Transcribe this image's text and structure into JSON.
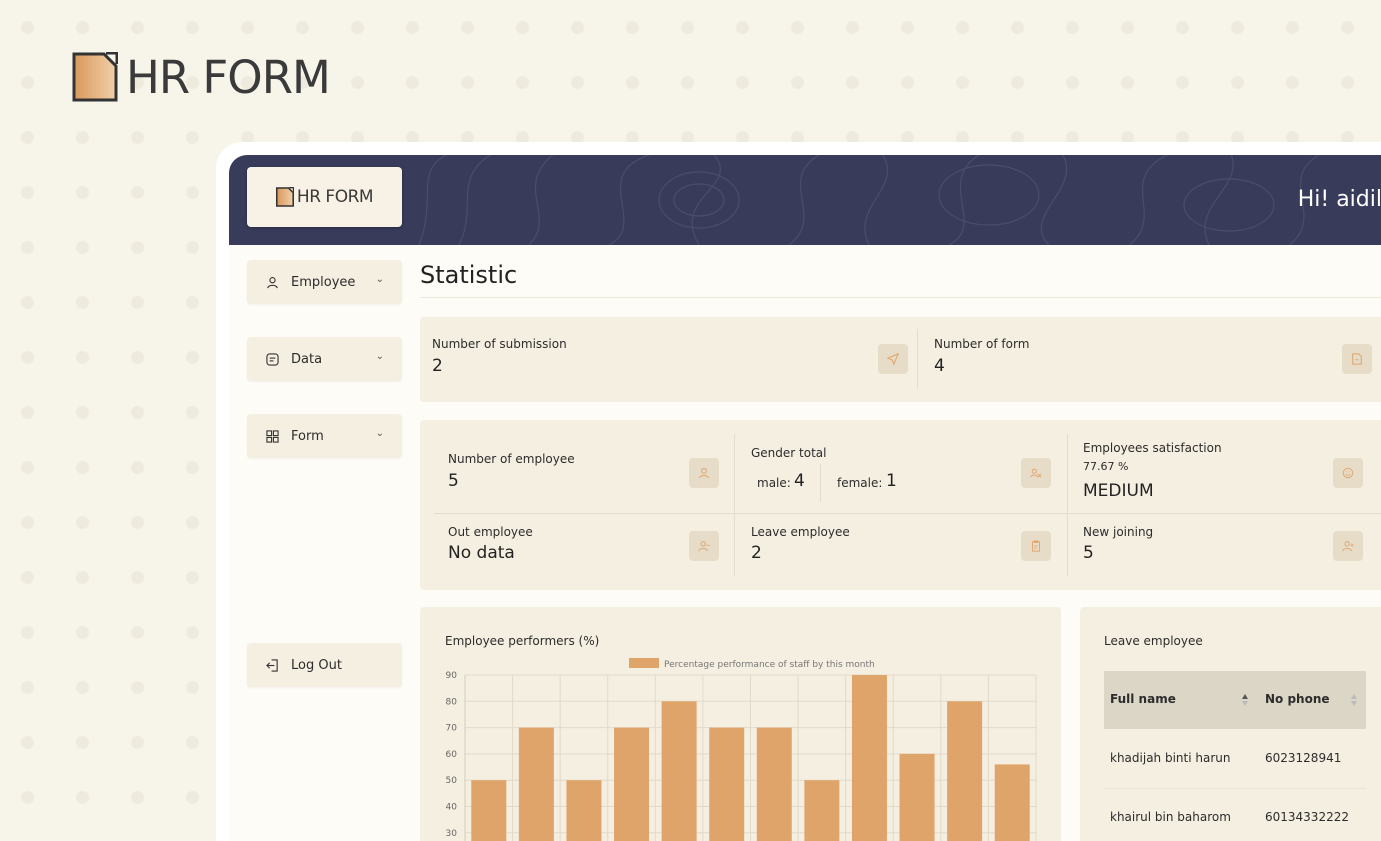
{
  "brand": {
    "name": "HR FORM"
  },
  "header": {
    "greeting": "Hi! aidil"
  },
  "sidebar": {
    "items": [
      {
        "label": "Employee",
        "icon": "user-icon"
      },
      {
        "label": "Data",
        "icon": "message-square-icon"
      },
      {
        "label": "Form",
        "icon": "grid-icon"
      }
    ],
    "logout": {
      "label": "Log Out",
      "icon": "logout-icon"
    }
  },
  "main": {
    "title": "Statistic",
    "top_stats": [
      {
        "label": "Number of submission",
        "value": "2",
        "icon": "send-icon"
      },
      {
        "label": "Number of form",
        "value": "4",
        "icon": "file-icon"
      }
    ],
    "employee_stats": {
      "number_of_employee": {
        "label": "Number of employee",
        "value": "5",
        "icon": "user-icon"
      },
      "gender_total": {
        "label": "Gender total",
        "male_label": "male:",
        "male_value": "4",
        "female_label": "female:",
        "female_value": "1",
        "icon": "users-icon"
      },
      "satisfaction": {
        "label": "Employees satisfaction",
        "percent": "77.67 %",
        "level": "MEDIUM",
        "icon": "smile-icon"
      },
      "out_employee": {
        "label": "Out employee",
        "value": "No data",
        "icon": "user-minus-icon"
      },
      "leave_employee": {
        "label": "Leave employee",
        "value": "2",
        "icon": "clipboard-icon"
      },
      "new_joining": {
        "label": "New joining",
        "value": "5",
        "icon": "user-plus-icon"
      }
    },
    "performance_card": {
      "title": "Employee performers (%)"
    },
    "leave_card": {
      "title": "Leave employee",
      "columns": [
        "Full name",
        "No phone"
      ],
      "rows": [
        [
          "khadijah binti harun",
          "6023128941"
        ],
        [
          "khairul bin baharom",
          "60134332222"
        ]
      ]
    }
  },
  "chart_data": {
    "type": "bar",
    "legend": "Percentage performance of staff by this month",
    "values": [
      50,
      70,
      50,
      70,
      80,
      70,
      70,
      50,
      90,
      60,
      80,
      56
    ],
    "y_ticks": [
      "90",
      "80",
      "70",
      "60",
      "50",
      "40",
      "30"
    ],
    "ylim_visible": [
      30,
      90
    ],
    "bar_color": "#dfa46a",
    "grid": true
  },
  "colors": {
    "accent": "#dfa46a",
    "header_bg": "#383b5a",
    "card_bg": "#f5efe2",
    "page_bg": "#f7f4e9"
  }
}
